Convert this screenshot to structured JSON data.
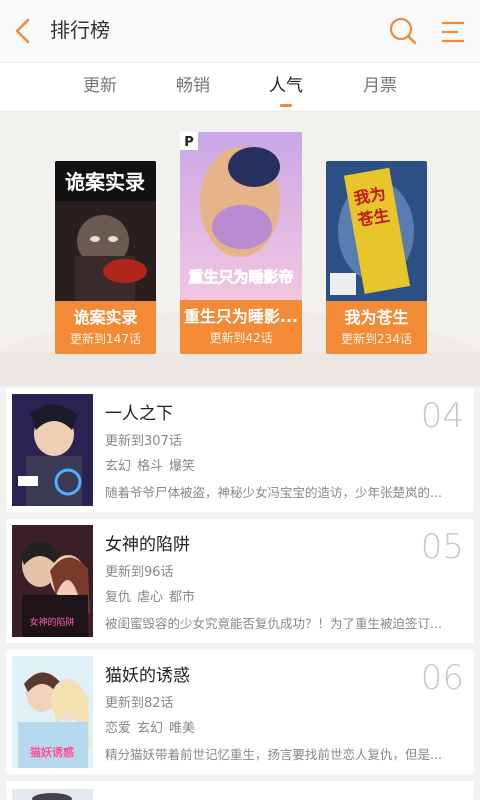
{
  "header": {
    "title": "排行榜",
    "back_icon": "chevron-left-icon",
    "search_icon": "search-icon",
    "menu_icon": "menu-icon",
    "accent": "#f08a3a"
  },
  "tabs": [
    {
      "label": "更新",
      "active": false
    },
    {
      "label": "畅销",
      "active": false
    },
    {
      "label": "人气",
      "active": true
    },
    {
      "label": "月票",
      "active": false
    }
  ],
  "podium": [
    {
      "title": "诡案实录",
      "update": "更新到147话",
      "cover_text": "诡案实录",
      "rank": 2
    },
    {
      "title": "重生只为睡影...",
      "update": "更新到42话",
      "cover_text": "重生只为睡影帝",
      "rank": 1
    },
    {
      "title": "我为苍生",
      "update": "更新到234话",
      "cover_text": "我为苍生",
      "rank": 3
    }
  ],
  "list": [
    {
      "rank": "04",
      "title": "一人之下",
      "update": "更新到307话",
      "tags": [
        "玄幻",
        "格斗",
        "爆笑"
      ],
      "desc": "随着爷爷尸体被盗，神秘少女冯宝宝的造访，少年张楚岚的..."
    },
    {
      "rank": "05",
      "title": "女神的陷阱",
      "update": "更新到96话",
      "tags": [
        "复仇",
        "虐心",
        "都市"
      ],
      "desc": "被闺蜜毁容的少女究竟能否复仇成功？！为了重生被迫签订..."
    },
    {
      "rank": "06",
      "title": "猫妖的诱惑",
      "update": "更新到82话",
      "tags": [
        "恋爱",
        "玄幻",
        "唯美"
      ],
      "desc": "精分猫妖带着前世记忆重生，扬言要找前世恋人复仇，但是..."
    }
  ]
}
